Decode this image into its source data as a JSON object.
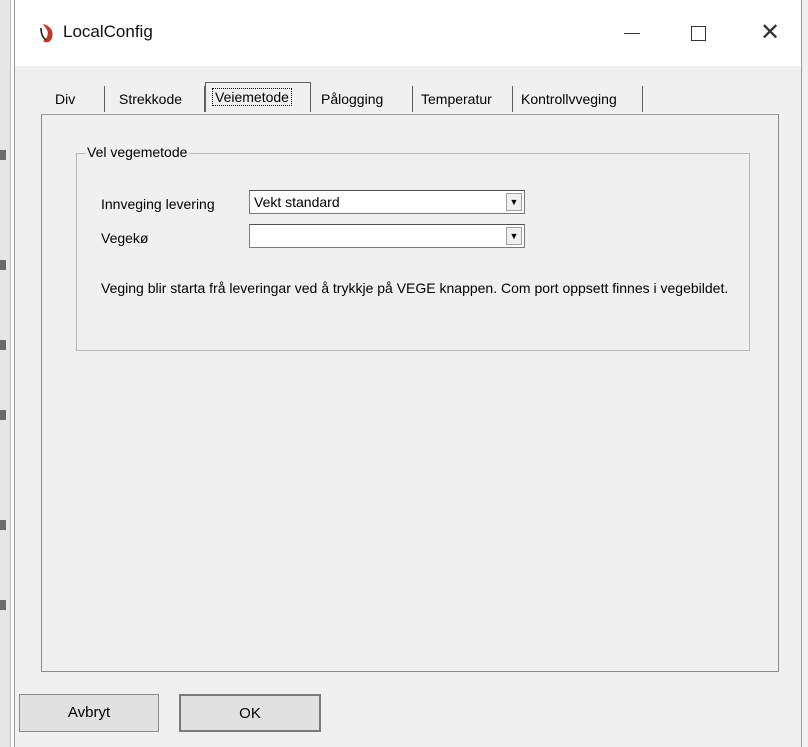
{
  "window": {
    "title": "LocalConfig",
    "controls": {
      "minimize": "minimize",
      "maximize": "maximize",
      "close": "✕"
    }
  },
  "tabs": [
    {
      "label": "Div"
    },
    {
      "label": "Strekkode"
    },
    {
      "label": "Veiemetode",
      "active": true
    },
    {
      "label": "Pålogging"
    },
    {
      "label": "Temperatur"
    },
    {
      "label": "Kontrollvveging"
    }
  ],
  "group": {
    "legend": "Vel vegemetode",
    "fields": [
      {
        "label": "Innveging levering",
        "value": "Vekt standard"
      },
      {
        "label": "Vegekø",
        "value": ""
      }
    ],
    "info": "Veging blir starta frå leveringar ved å trykkje på VEGE knappen. Com port oppsett finnes i vegebildet."
  },
  "buttons": {
    "cancel": "Avbryt",
    "ok": "OK"
  },
  "colors": {
    "window_bg": "#f0f0f0",
    "icon_red": "#c0392b"
  }
}
